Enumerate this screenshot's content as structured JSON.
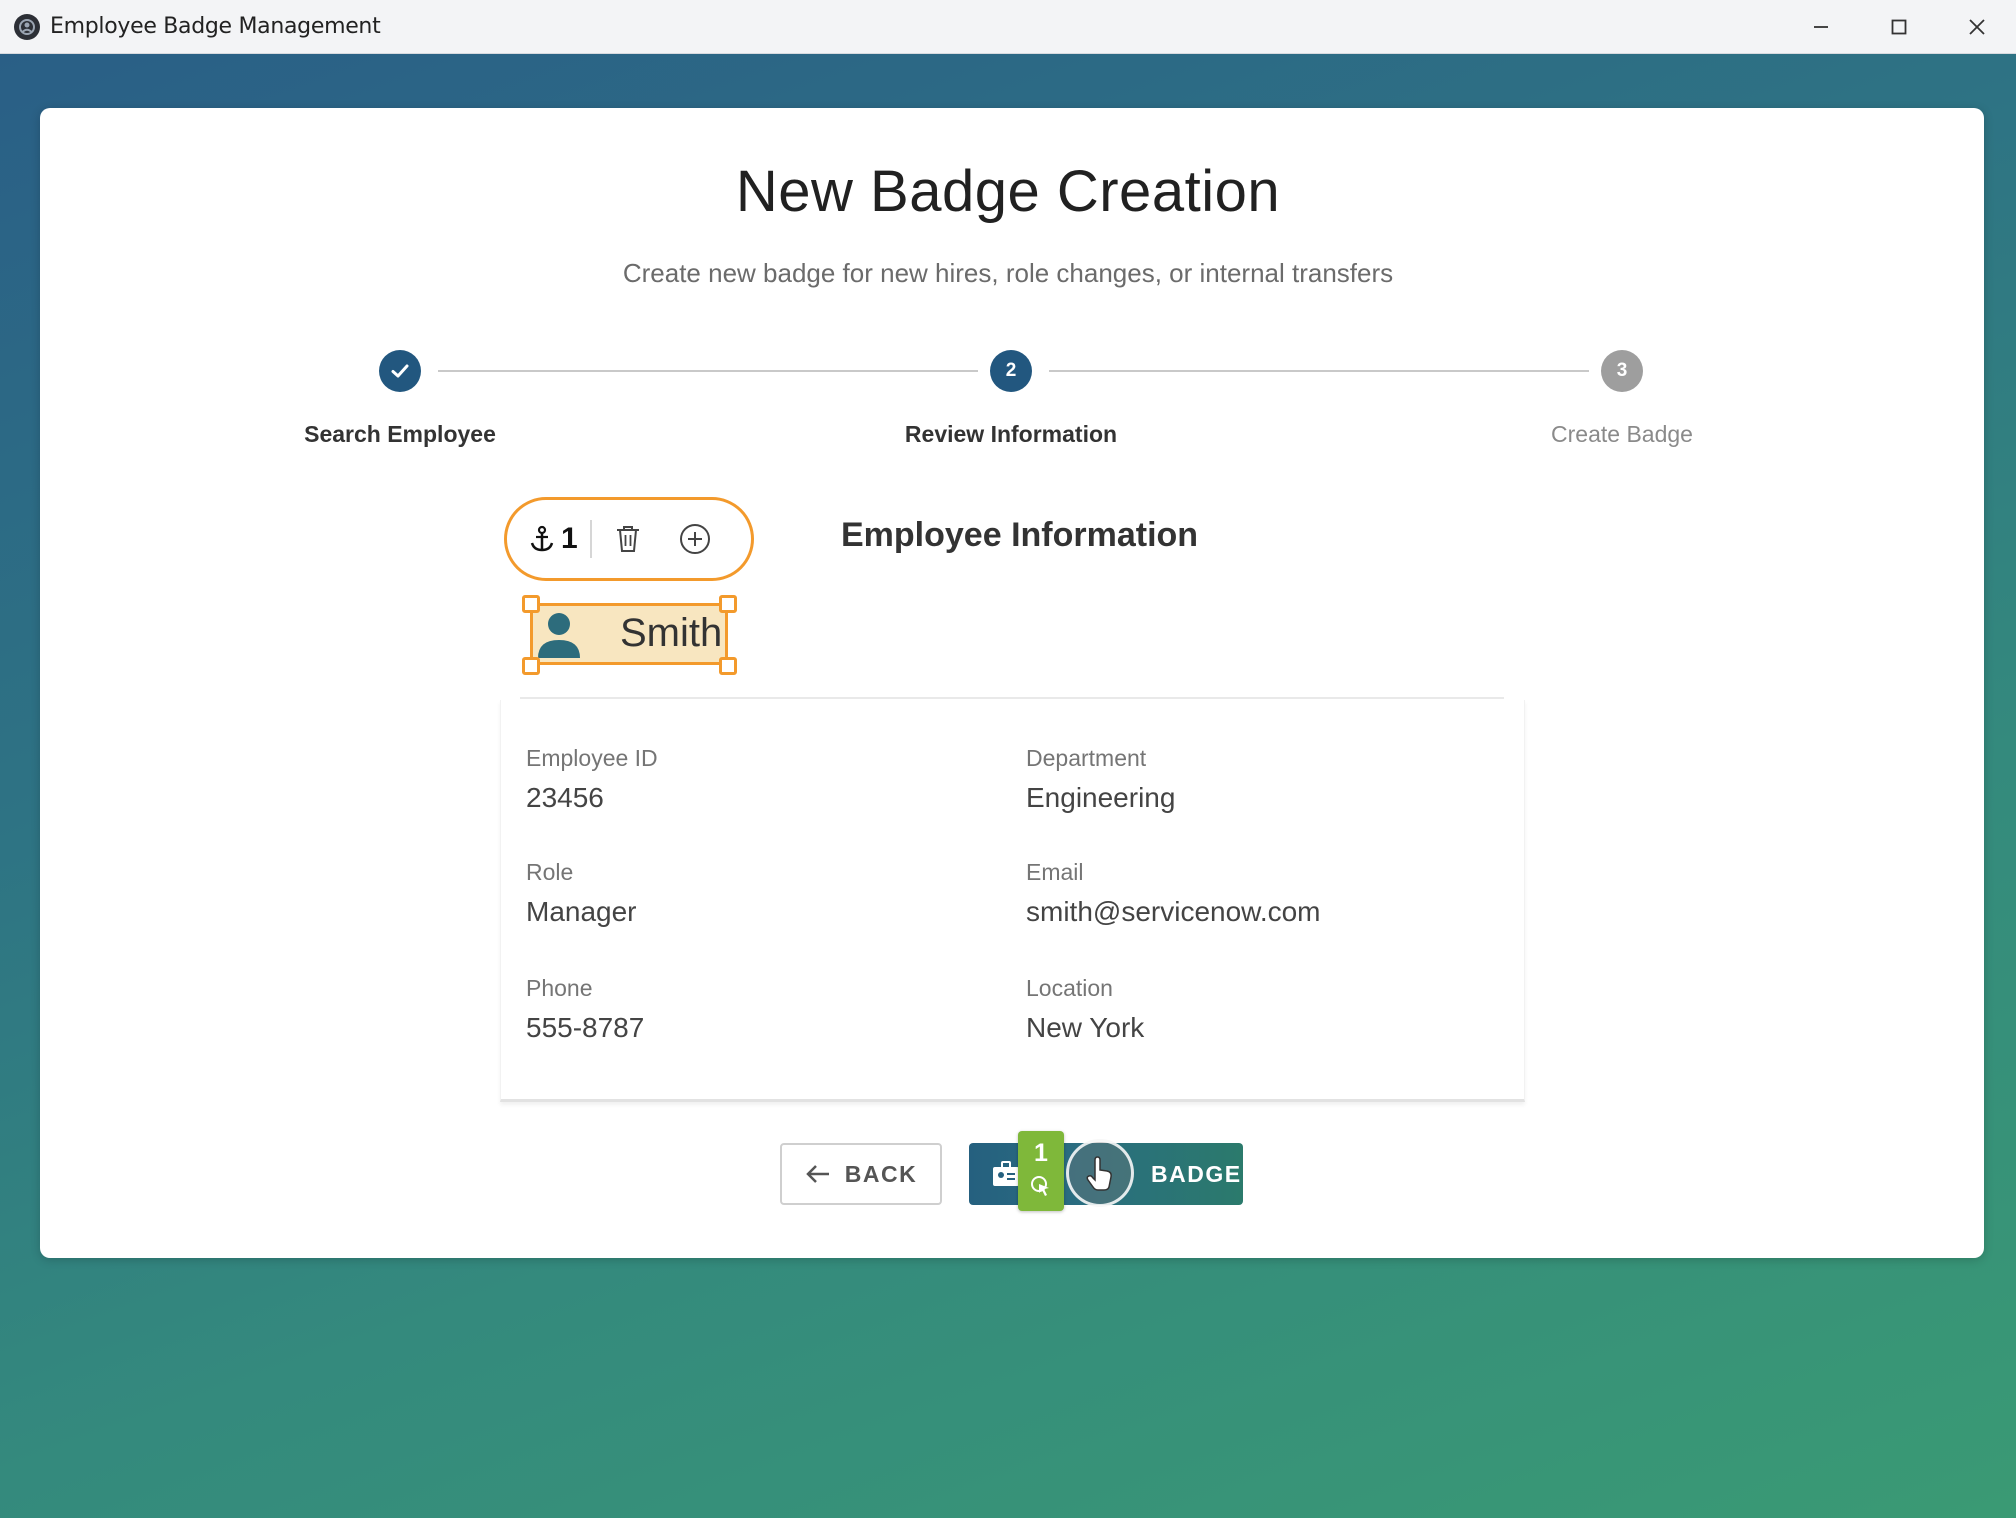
{
  "window": {
    "title": "Employee Badge Management"
  },
  "page": {
    "title": "New Badge Creation",
    "subtitle": "Create new badge for new hires, role changes, or internal transfers"
  },
  "stepper": {
    "steps": [
      {
        "label": "Search Employee",
        "state": "completed",
        "number": "1"
      },
      {
        "label": "Review Information",
        "state": "active",
        "number": "2"
      },
      {
        "label": "Create Badge",
        "state": "inactive",
        "number": "3"
      }
    ],
    "colors": {
      "active": "#22577f",
      "inactive": "#9e9e9e",
      "line": "#c9c9c9"
    }
  },
  "section": {
    "title": "Employee Information"
  },
  "employee": {
    "name": "Smith",
    "fields": [
      {
        "label": "Employee ID",
        "value": "23456"
      },
      {
        "label": "Department",
        "value": "Engineering"
      },
      {
        "label": "Role",
        "value": "Manager"
      },
      {
        "label": "Email",
        "value": "smith@servicenow.com"
      },
      {
        "label": "Phone",
        "value": "555-8787"
      },
      {
        "label": "Location",
        "value": "New York"
      }
    ]
  },
  "annotation": {
    "anchor_number": "1",
    "click_marker_number": "1",
    "accent_color": "#f39a2c",
    "marker_color": "#7fb83a"
  },
  "actions": {
    "back_label": "BACK",
    "create_label": "BADGE"
  }
}
